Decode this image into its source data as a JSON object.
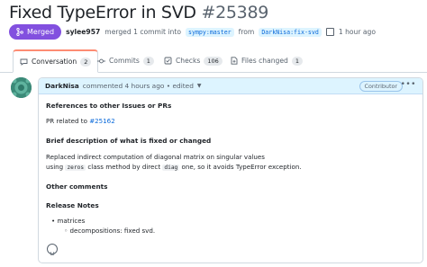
{
  "pr": {
    "title": "Fixed TypeError in SVD",
    "number": "#25389",
    "status": "Merged",
    "author": "sylee957",
    "merge_text": "merged 1 commit into",
    "base_branch": "sympy:master",
    "from_word": "from",
    "head_branch": "DarkNisa:fix-svd",
    "time": "1 hour ago"
  },
  "tabs": [
    {
      "label": "Conversation",
      "count": "2",
      "icon": "comment-icon"
    },
    {
      "label": "Commits",
      "count": "1",
      "icon": "commit-icon"
    },
    {
      "label": "Checks",
      "count": "106",
      "icon": "checklist-icon"
    },
    {
      "label": "Files changed",
      "count": "1",
      "icon": "file-diff-icon"
    }
  ],
  "comment": {
    "author": "DarkNisa",
    "meta": "commented 4 hours ago • edited",
    "role": "Contributor",
    "sections": {
      "refs_heading": "References to other Issues or PRs",
      "refs_text": "PR related to",
      "refs_link": "#25162",
      "desc_heading": "Brief description of what is fixed or changed",
      "desc_line1": "Replaced indirect computation of diagonal matrix on singular values",
      "desc_using": "using",
      "desc_code1": "zeros",
      "desc_mid": "class method by direct",
      "desc_code2": "diag",
      "desc_end": "one, so it avoids TypeError exception.",
      "other_heading": "Other comments",
      "release_heading": "Release Notes",
      "release_item": "matrices",
      "release_subitem": "decompositions: fixed svd."
    }
  },
  "colors": {
    "merged": "#8250df",
    "link": "#0969da",
    "header_bg": "#ddf4ff",
    "tab_accent": "#fd8c73"
  }
}
